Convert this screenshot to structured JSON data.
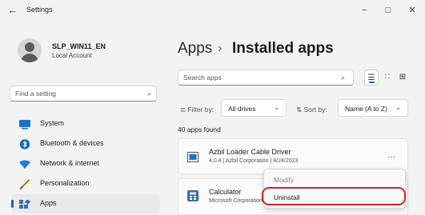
{
  "window": {
    "title": "Settings",
    "back_icon": "←",
    "minimize_icon": "−",
    "maximize_icon": "□",
    "close_icon": "✕"
  },
  "user": {
    "name": "SLP_WIN11_EN",
    "type": "Local Account"
  },
  "search": {
    "placeholder": "Find a setting",
    "icon": "⌕"
  },
  "sidebar": {
    "items": [
      {
        "label": "System",
        "icon": "monitor-icon",
        "color": "#1f6fc6"
      },
      {
        "label": "Bluetooth & devices",
        "icon": "bluetooth-icon",
        "color": "#1565c0"
      },
      {
        "label": "Network & internet",
        "icon": "wifi-icon",
        "color": "#1a7fd6"
      },
      {
        "label": "Personalization",
        "icon": "brush-icon",
        "color": "#c9781c"
      },
      {
        "label": "Apps",
        "icon": "apps-icon",
        "color": "#3b6fb3",
        "selected": true
      }
    ]
  },
  "main": {
    "breadcrumb_parent": "Apps",
    "breadcrumb_sep": "›",
    "breadcrumb_current": "Installed apps",
    "search_placeholder": "Search apps",
    "search_icon": "⌕",
    "view_list_icon": "☰",
    "view_grid_icon": "∷",
    "view_tiles_icon": "⊞",
    "filter_label": "≣ Filter by:",
    "filter_value": "All drives",
    "sort_label": "⇅ Sort by:",
    "sort_value": "Name (A to Z)",
    "chevron": "⌄",
    "apps_count": "40 apps found",
    "apps": [
      {
        "name": "Azbil Loader Cable Driver",
        "meta": "4.0.4  |  Azbil Corporation  |  8/24/2023",
        "icon": "driver-icon"
      },
      {
        "name": "Calculator",
        "meta": "Microsoft Corporation",
        "icon": "calculator-icon"
      }
    ],
    "more_icon": "…"
  },
  "context_menu": {
    "items": [
      {
        "label": "Modify",
        "enabled": false
      },
      {
        "label": "Uninstall",
        "enabled": true
      }
    ],
    "highlight_color": "#c8242d"
  }
}
